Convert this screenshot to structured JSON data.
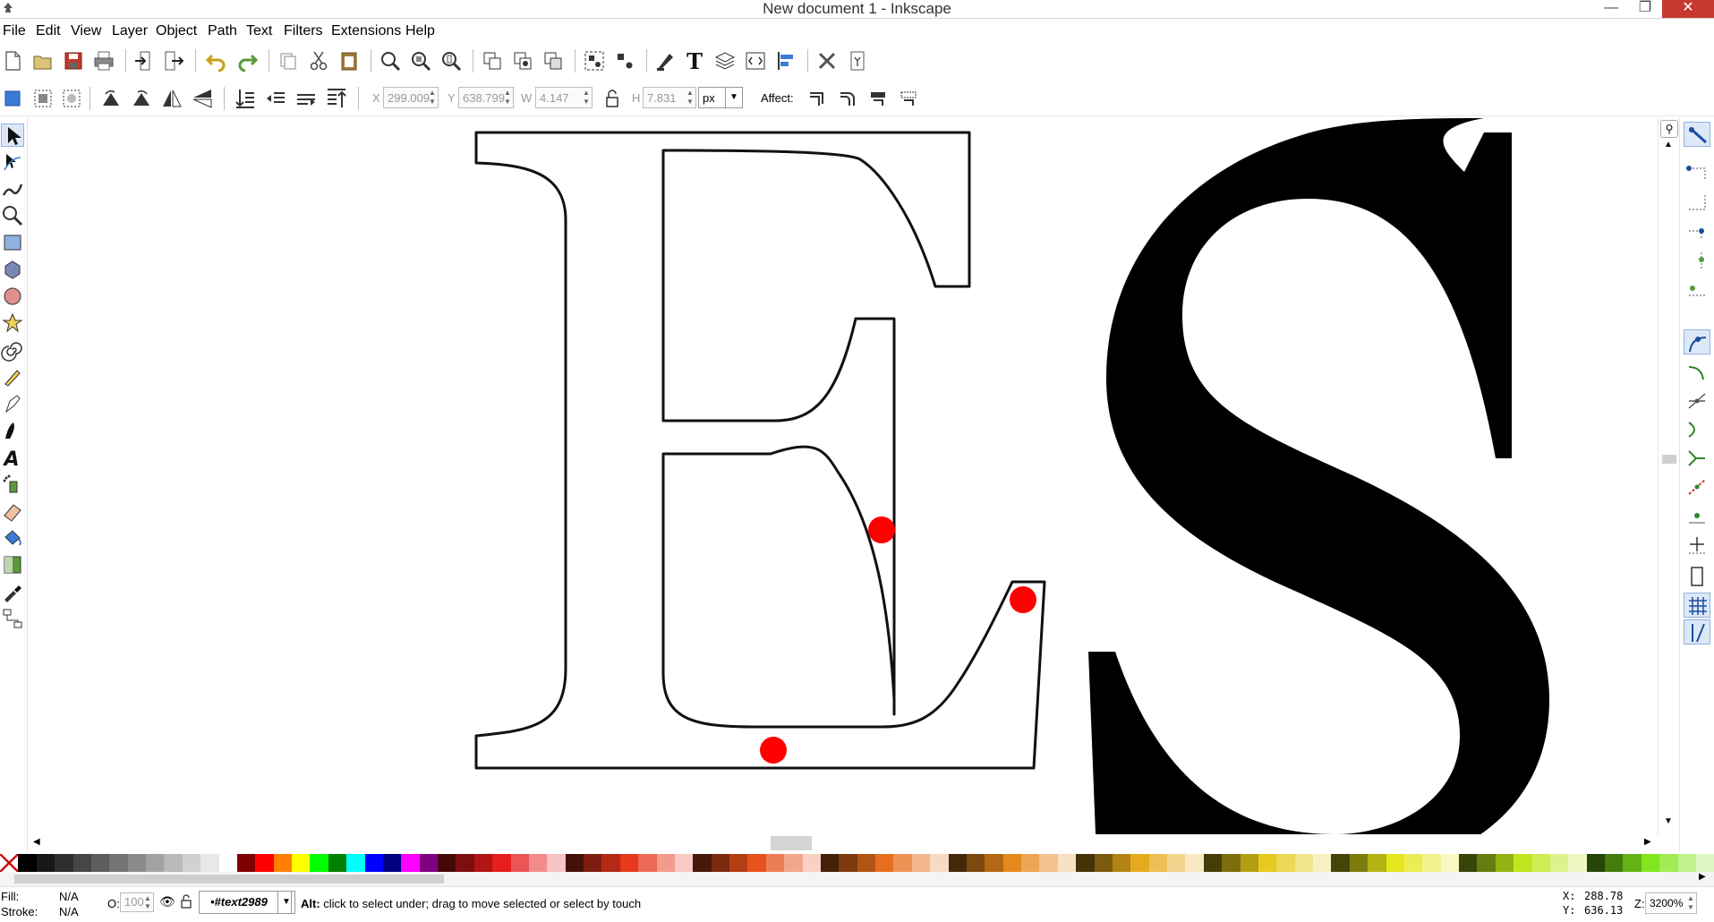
{
  "window": {
    "title": "New document 1 - Inkscape",
    "minimize": "—",
    "maximize": "❐",
    "close": "✕"
  },
  "menu": [
    "File",
    "Edit",
    "View",
    "Layer",
    "Object",
    "Path",
    "Text",
    "Filters",
    "Extensions",
    "Help"
  ],
  "select_toolbar": {
    "x_label": "X",
    "x_value": "299.009",
    "y_label": "Y",
    "y_value": "638.799",
    "w_label": "W",
    "w_value": "4.147",
    "h_label": "H",
    "h_value": "7.831",
    "unit": "px",
    "affect_label": "Affect:"
  },
  "status": {
    "fill_label": "Fill:",
    "fill_value": "N/A",
    "stroke_label": "Stroke:",
    "stroke_value": "N/A",
    "opacity_label": "O:",
    "opacity_value": "100",
    "layer": "•#text2989",
    "message_bold": "Alt:",
    "message": " click to select under; drag to move selected or select by touch",
    "cursor_x_label": "X:",
    "cursor_x": "288.78",
    "cursor_y_label": "Y:",
    "cursor_y": "636.13",
    "zoom_label": "Z:",
    "zoom": "3200%"
  },
  "canvas": {
    "letter_outline": "E",
    "letter_filled": "S"
  },
  "colors": {
    "close_button": "#c7392f",
    "active_tool": "#dde8f7",
    "node_marker": "#ff0000"
  }
}
